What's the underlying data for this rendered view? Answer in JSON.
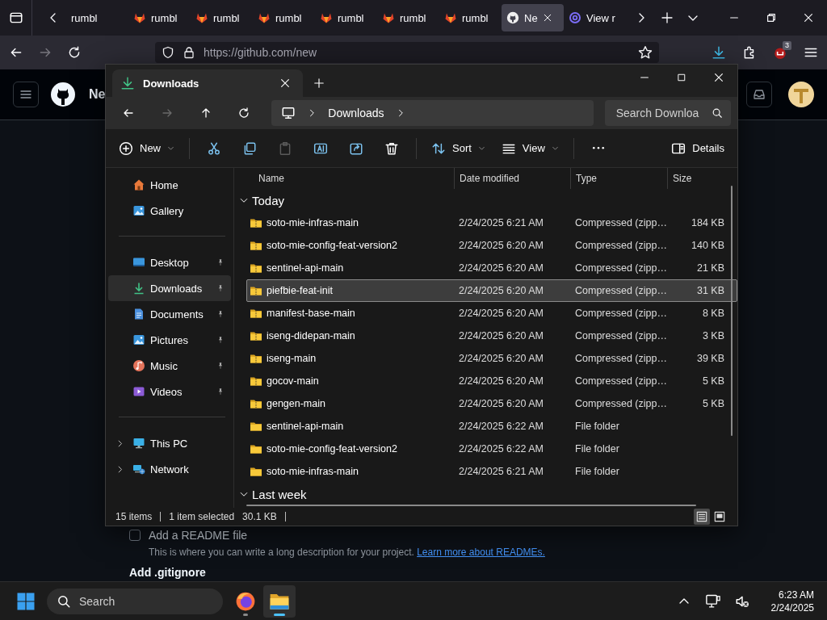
{
  "browser": {
    "tabs": [
      {
        "label": "rumbl",
        "kind": "none",
        "selected": false
      },
      {
        "label": "rumbl",
        "kind": "fox",
        "selected": false
      },
      {
        "label": "rumbl",
        "kind": "fox",
        "selected": false
      },
      {
        "label": "rumbl",
        "kind": "fox",
        "selected": false
      },
      {
        "label": "rumbl",
        "kind": "fox",
        "selected": false
      },
      {
        "label": "rumbl",
        "kind": "fox",
        "selected": false
      },
      {
        "label": "rumbl",
        "kind": "fox",
        "selected": false
      },
      {
        "label": "Ne",
        "kind": "github",
        "selected": true
      },
      {
        "label": "View r",
        "kind": "at",
        "selected": false
      }
    ],
    "url": "https://github.com/new",
    "extension_badge": "3"
  },
  "github": {
    "title": "Ne",
    "readme_label": "Add a README file",
    "readme_checked": false,
    "readme_help": "This is where you can write a long description for your project. ",
    "readme_link": "Learn more about READMEs.",
    "gitignore_heading": "Add .gitignore"
  },
  "explorer": {
    "tab_title": "Downloads",
    "breadcrumb": [
      "Downloads"
    ],
    "search_placeholder": "Search Downloa",
    "toolbar": [
      {
        "kind": "new",
        "label": "New",
        "disabled": false
      },
      {
        "kind": "cut",
        "disabled": false
      },
      {
        "kind": "copy",
        "disabled": false
      },
      {
        "kind": "paste",
        "disabled": true
      },
      {
        "kind": "rename",
        "disabled": false
      },
      {
        "kind": "share",
        "disabled": false
      },
      {
        "kind": "delete",
        "disabled": false
      },
      {
        "kind": "sort",
        "label": "Sort",
        "disabled": false
      },
      {
        "kind": "view",
        "label": "View",
        "disabled": false
      },
      {
        "kind": "more",
        "disabled": false
      },
      {
        "kind": "details",
        "label": "Details",
        "disabled": false
      }
    ],
    "sidebar": [
      {
        "items": [
          {
            "label": "Home",
            "kind": "home",
            "pinned": false,
            "selected": false
          },
          {
            "label": "Gallery",
            "kind": "gallery",
            "pinned": false,
            "selected": false
          }
        ]
      },
      {
        "items": [
          {
            "label": "Desktop",
            "kind": "desktop",
            "pinned": true,
            "selected": false
          },
          {
            "label": "Downloads",
            "kind": "downloads",
            "pinned": true,
            "selected": true
          },
          {
            "label": "Documents",
            "kind": "documents",
            "pinned": true,
            "selected": false
          },
          {
            "label": "Pictures",
            "kind": "pictures",
            "pinned": true,
            "selected": false
          },
          {
            "label": "Music",
            "kind": "music",
            "pinned": true,
            "selected": false
          },
          {
            "label": "Videos",
            "kind": "videos",
            "pinned": true,
            "selected": false
          }
        ]
      },
      {
        "items": [
          {
            "label": "This PC",
            "kind": "pc",
            "expanded": false,
            "selected": false
          },
          {
            "label": "Network",
            "kind": "network",
            "expanded": false,
            "selected": false
          }
        ]
      }
    ],
    "columns": [
      "Name",
      "Date modified",
      "Type",
      "Size"
    ],
    "groups": [
      {
        "label": "Today",
        "expanded": true,
        "files": [
          {
            "name": "soto-mie-infras-main",
            "date": "2/24/2025 6:21 AM",
            "type": "Compressed (zipp…",
            "size": "184 KB",
            "kind": "zip",
            "selected": false
          },
          {
            "name": "soto-mie-config-feat-version2",
            "date": "2/24/2025 6:20 AM",
            "type": "Compressed (zipp…",
            "size": "140 KB",
            "kind": "zip",
            "selected": false
          },
          {
            "name": "sentinel-api-main",
            "date": "2/24/2025 6:20 AM",
            "type": "Compressed (zipp…",
            "size": "21 KB",
            "kind": "zip",
            "selected": false
          },
          {
            "name": "piefbie-feat-init",
            "date": "2/24/2025 6:20 AM",
            "type": "Compressed (zipp…",
            "size": "31 KB",
            "kind": "zip",
            "selected": true
          },
          {
            "name": "manifest-base-main",
            "date": "2/24/2025 6:20 AM",
            "type": "Compressed (zipp…",
            "size": "8 KB",
            "kind": "zip",
            "selected": false
          },
          {
            "name": "iseng-didepan-main",
            "date": "2/24/2025 6:20 AM",
            "type": "Compressed (zipp…",
            "size": "3 KB",
            "kind": "zip",
            "selected": false
          },
          {
            "name": "iseng-main",
            "date": "2/24/2025 6:20 AM",
            "type": "Compressed (zipp…",
            "size": "39 KB",
            "kind": "zip",
            "selected": false
          },
          {
            "name": "gocov-main",
            "date": "2/24/2025 6:20 AM",
            "type": "Compressed (zipp…",
            "size": "5 KB",
            "kind": "zip",
            "selected": false
          },
          {
            "name": "gengen-main",
            "date": "2/24/2025 6:20 AM",
            "type": "Compressed (zipp…",
            "size": "5 KB",
            "kind": "zip",
            "selected": false
          },
          {
            "name": "sentinel-api-main",
            "date": "2/24/2025 6:22 AM",
            "type": "File folder",
            "kind": "folder",
            "selected": false
          },
          {
            "name": "soto-mie-config-feat-version2",
            "date": "2/24/2025 6:22 AM",
            "type": "File folder",
            "kind": "folder",
            "selected": false
          },
          {
            "name": "soto-mie-infras-main",
            "date": "2/24/2025 6:21 AM",
            "type": "File folder",
            "kind": "folder",
            "selected": false
          }
        ]
      },
      {
        "label": "Last week",
        "expanded": true
      }
    ],
    "status": {
      "count": "15 items",
      "selection": "1 item selected",
      "size": "30.1 KB"
    },
    "views": [
      {
        "kind": "details",
        "selected": true
      },
      {
        "kind": "tiles",
        "selected": false
      }
    ]
  },
  "taskbar": {
    "search_placeholder": "Search",
    "apps": [
      {
        "kind": "firefox",
        "active": false
      },
      {
        "kind": "explorer",
        "active": true
      }
    ],
    "time": "6:23 AM",
    "date": "2/24/2025"
  }
}
